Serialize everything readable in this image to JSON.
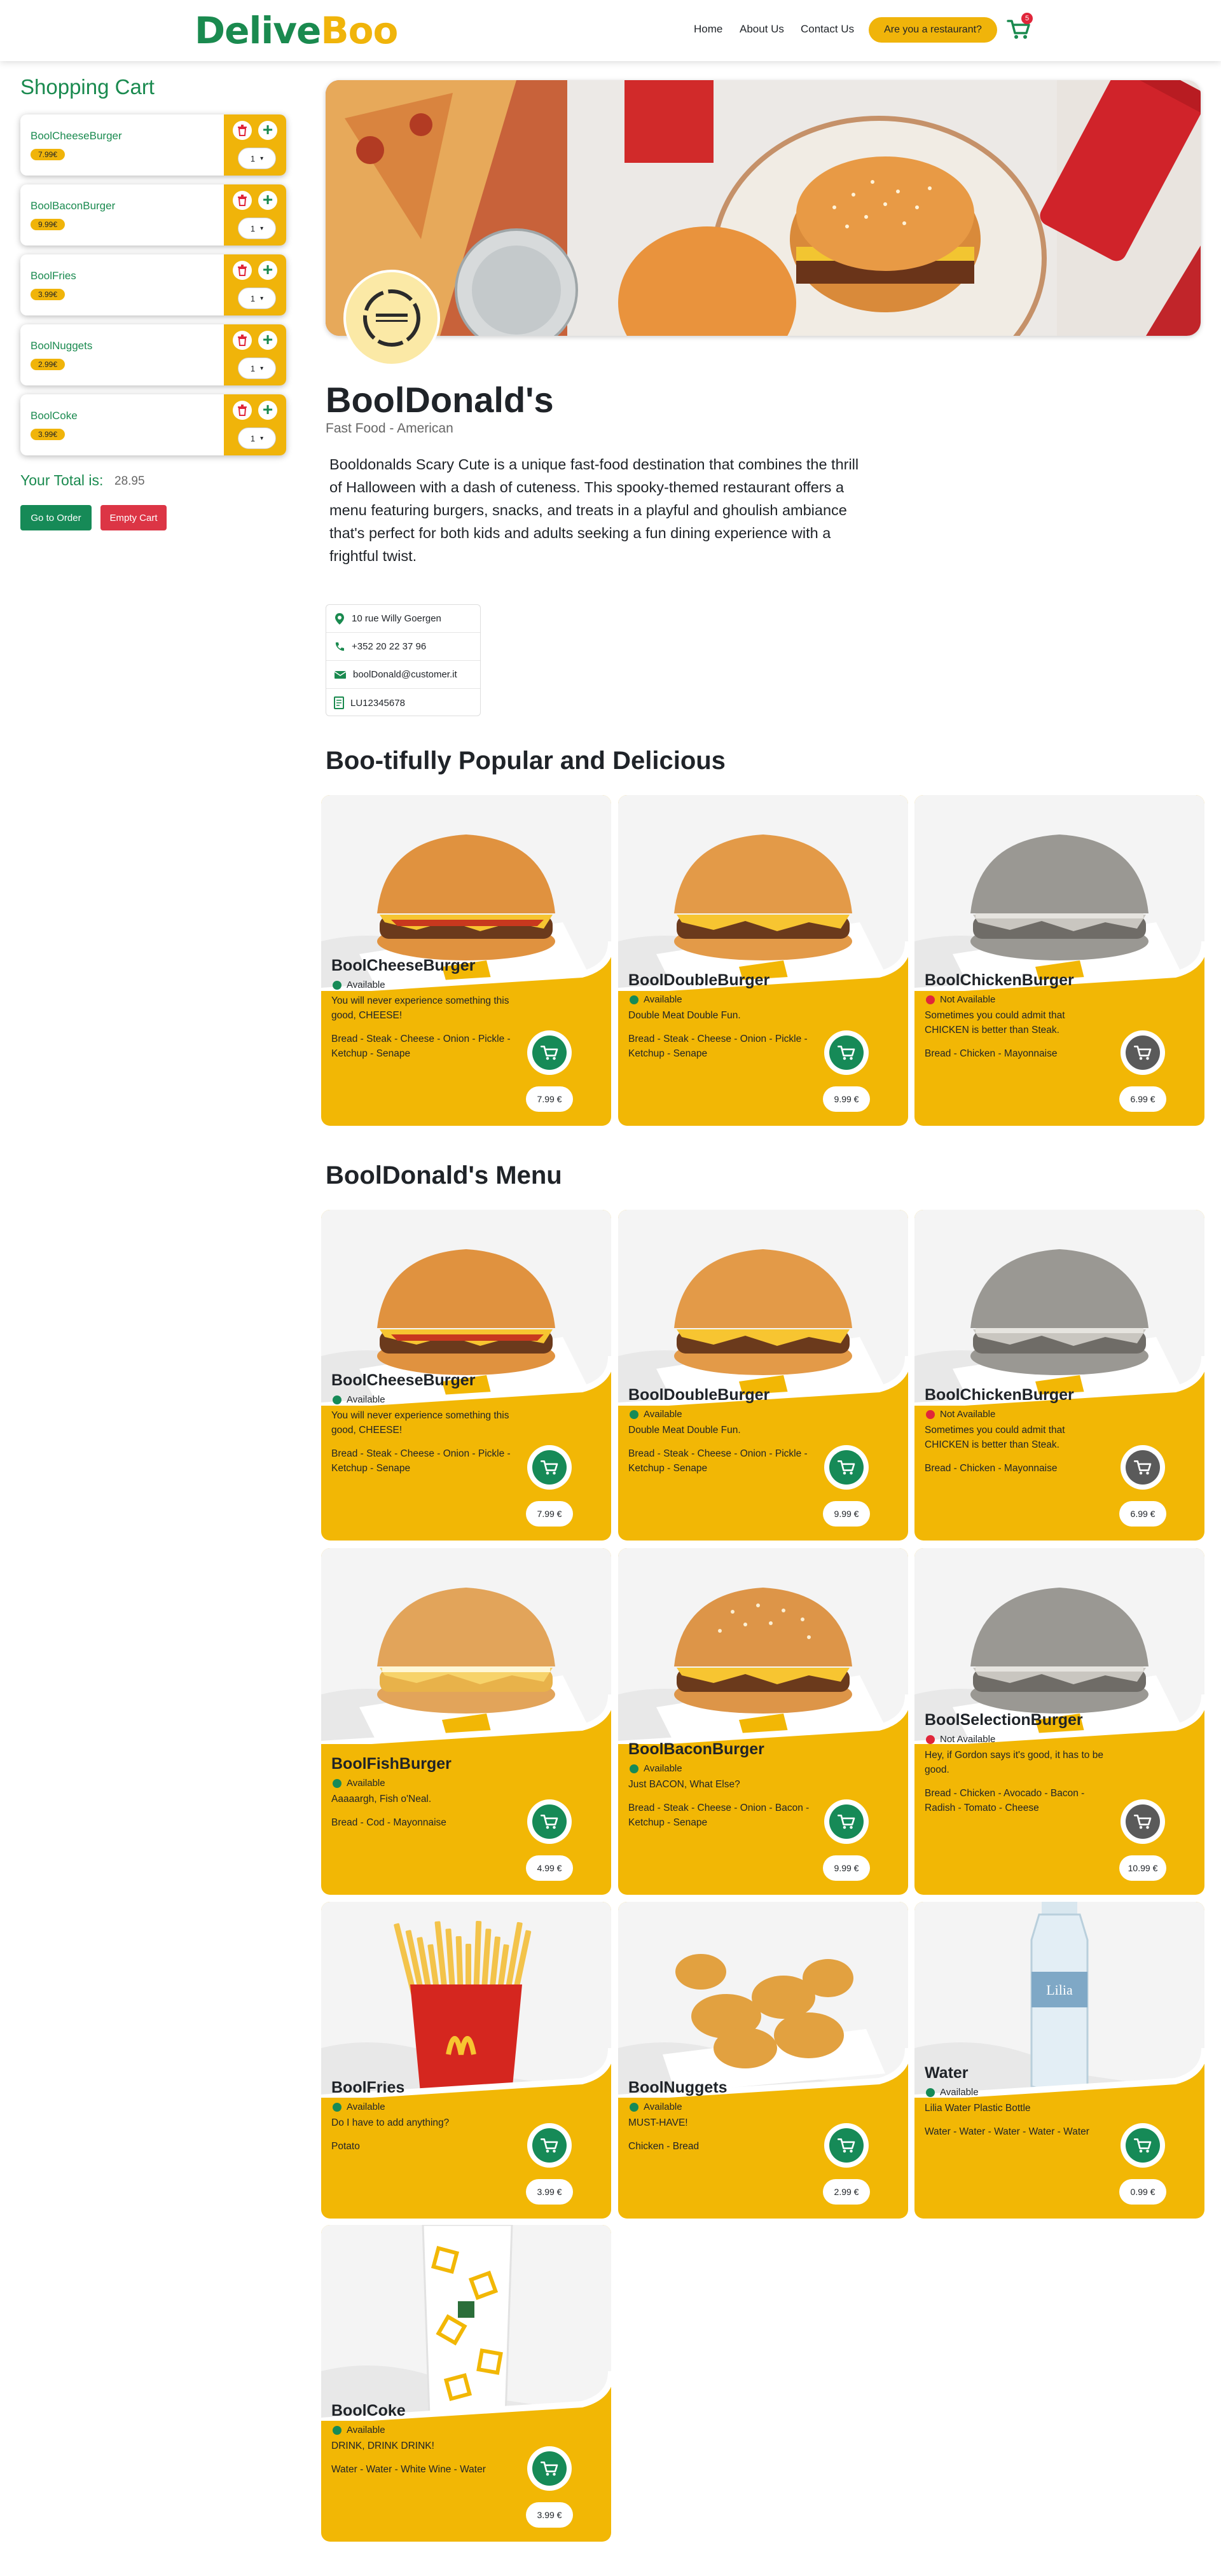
{
  "header": {
    "logo_part1": "Delive",
    "logo_part2": "Boo",
    "nav": [
      "Home",
      "About Us",
      "Contact Us"
    ],
    "restaurant_button": "Are you a restaurant?",
    "cart_count": "5"
  },
  "colors": {
    "green": "#1a8a4f",
    "yellow": "#f2b705",
    "red": "#dc3545"
  },
  "cart": {
    "title": "Shopping Cart",
    "items": [
      {
        "name": "BoolCheeseBurger",
        "price": "7.99€",
        "qty": "1"
      },
      {
        "name": "BoolBaconBurger",
        "price": "9.99€",
        "qty": "1"
      },
      {
        "name": "BoolFries",
        "price": "3.99€",
        "qty": "1"
      },
      {
        "name": "BoolNuggets",
        "price": "2.99€",
        "qty": "1"
      },
      {
        "name": "BoolCoke",
        "price": "3.99€",
        "qty": "1"
      }
    ],
    "total_label": "Your Total is:",
    "total_value": "28.95",
    "order_button": "Go to Order",
    "empty_button": "Empty Cart"
  },
  "restaurant": {
    "name": "BoolDonald's",
    "types": [
      "Fast Food",
      "American"
    ],
    "description": "Booldonalds Scary Cute is a unique fast-food destination that combines the thrill of Halloween with a dash of cuteness. This spooky-themed restaurant offers a menu featuring burgers, snacks, and treats in a playful and ghoulish ambiance that's perfect for both kids and adults seeking a fun dining experience with a frightful twist.",
    "address": "10 rue Willy Goergen",
    "phone": "+352 20 22 37 96",
    "email": "boolDonald@customer.it",
    "vat": "LU12345678"
  },
  "sections": {
    "popular_title": "Boo-tifully Popular and Delicious",
    "menu_title": "BoolDonald's Menu"
  },
  "popular": [
    {
      "name": "BoolCheeseBurger",
      "status": "Available",
      "available": true,
      "desc": "You will never experience something this good, CHEESE!",
      "ingredients": "Bread  -  Steak  -  Cheese  -  Onion  -  Pickle  -  Ketchup  -  Senape",
      "price": "7.99 €",
      "image": "burger-icon"
    },
    {
      "name": "BoolDoubleBurger",
      "status": "Available",
      "available": true,
      "desc": "Double Meat Double Fun.",
      "ingredients": "Bread  -  Steak  -  Cheese  -  Onion  -  Pickle  -  Ketchup  -  Senape",
      "price": "9.99 €",
      "image": "double-burger-icon"
    },
    {
      "name": "BoolChickenBurger",
      "status": "Not Available",
      "available": false,
      "desc": "Sometimes you could admit that CHICKEN is better than Steak.",
      "ingredients": "Bread  -  Chicken  -  Mayonnaise",
      "price": "6.99 €",
      "image": "grey-burger-icon"
    }
  ],
  "menu": [
    {
      "name": "BoolCheeseBurger",
      "status": "Available",
      "available": true,
      "desc": "You will never experience something this good, CHEESE!",
      "ingredients": "Bread  -  Steak  -  Cheese  -  Onion  -  Pickle  -  Ketchup  -  Senape",
      "price": "7.99 €",
      "image": "burger-icon"
    },
    {
      "name": "BoolDoubleBurger",
      "status": "Available",
      "available": true,
      "desc": "Double Meat Double Fun.",
      "ingredients": "Bread  -  Steak  -  Cheese  -  Onion  -  Pickle  -  Ketchup  -  Senape",
      "price": "9.99 €",
      "image": "double-burger-icon"
    },
    {
      "name": "BoolChickenBurger",
      "status": "Not Available",
      "available": false,
      "desc": "Sometimes you could admit that CHICKEN is better than Steak.",
      "ingredients": "Bread  -  Chicken  -  Mayonnaise",
      "price": "6.99 €",
      "image": "grey-burger-icon"
    },
    {
      "name": "BoolFishBurger",
      "status": "Available",
      "available": true,
      "desc": "Aaaaargh, Fish o'Neal.",
      "ingredients": "Bread  -  Cod  -  Mayonnaise",
      "price": "4.99 €",
      "image": "fish-burger-icon"
    },
    {
      "name": "BoolBaconBurger",
      "status": "Available",
      "available": true,
      "desc": "Just BACON, What Else?",
      "ingredients": "Bread  -  Steak  -  Cheese  -  Onion  -  Bacon  -  Ketchup  -  Senape",
      "price": "9.99 €",
      "image": "bacon-burger-icon"
    },
    {
      "name": "BoolSelectionBurger",
      "status": "Not Available",
      "available": false,
      "desc": "Hey, if Gordon says it's good, it has to be good.",
      "ingredients": "Bread  -  Chicken  -  Avocado  -  Bacon  -  Radish  -  Tomato  -  Cheese",
      "price": "10.99 €",
      "image": "grey-burger-icon"
    },
    {
      "name": "BoolFries",
      "status": "Available",
      "available": true,
      "desc": "Do I have to add anything?",
      "ingredients": "Potato",
      "price": "3.99 €",
      "image": "fries-icon"
    },
    {
      "name": "BoolNuggets",
      "status": "Available",
      "available": true,
      "desc": "MUST-HAVE!",
      "ingredients": "Chicken  -  Bread",
      "price": "2.99 €",
      "image": "nuggets-icon"
    },
    {
      "name": "Water",
      "status": "Available",
      "available": true,
      "desc": "Lilia Water Plastic Bottle",
      "ingredients": "Water  -  Water  -  Water  -  Water  -  Water",
      "price": "0.99 €",
      "image": "water-bottle-icon"
    },
    {
      "name": "BoolCoke",
      "status": "Available",
      "available": true,
      "desc": "DRINK, DRINK DRINK!",
      "ingredients": "Water  -  Water  -  White Wine  -  Water",
      "price": "3.99 €",
      "image": "cup-icon"
    }
  ]
}
